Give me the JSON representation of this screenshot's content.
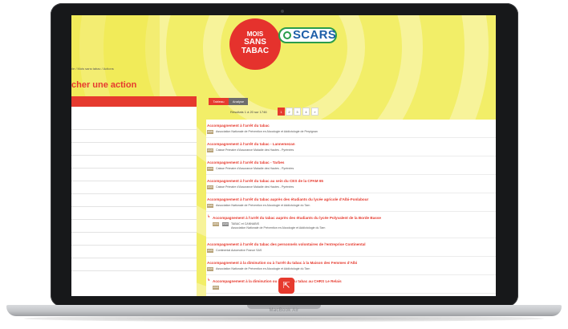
{
  "device": {
    "label": "MacBook Air"
  },
  "logo": {
    "line1": "MOIS",
    "line2": "SANS",
    "line3": "TABAC"
  },
  "brand": {
    "name": "SCARS",
    "colors": {
      "red": "#e63a2e",
      "yellow": "#f2ee68",
      "green": "#2a9d4b",
      "blue": "#1d5ea8"
    }
  },
  "breadcrumb": "ıle  /  Mois sans tabac  /  Actions",
  "page_title": "cher une action",
  "tabs": [
    {
      "label": "Tableau"
    },
    {
      "label": "Analyse"
    }
  ],
  "results": {
    "text": "Résultats 1 à 20 sur 1746"
  },
  "pagination": [
    "1",
    "2",
    "3",
    "4",
    "»"
  ],
  "items": [
    {
      "title": "Accompagnement à l'arrêt du tabac",
      "tag": "2020",
      "org": "Association Nationale de Prévention en Alcoologie et Addictologie de Perpignan"
    },
    {
      "title": "Accompagnement à l'arrêt du tabac - Lannemezan",
      "tag": "2020",
      "org": "Caisse Primaire d'Assurance Maladie des Hautes - Pyrénées"
    },
    {
      "title": "Accompagnement à l'arrêt du tabac - Tarbes",
      "tag": "2020",
      "org": "Caisse Primaire d'Assurance Maladie des Hautes - Pyrénées"
    },
    {
      "title": "Accompagnement à l'arrêt du tabac au sein du CES de la CPAM 65",
      "tag": "2020",
      "org": "Caisse Primaire d'Assurance Maladie des Hautes - Pyrénées"
    },
    {
      "title": "Accompagnement à l'arrêt du tabac auprès des étudiants du lycée agricole d'Albi-Fonlabour",
      "tag": "2020",
      "org": "Association Nationale de Prévention en Alcoologie et Addictologie du Tarn"
    },
    {
      "title": "Accompagnement à l'arrêt du tabac auprès des étudiants du lycée Polyvalent de la Borde Basse",
      "tag": "2019",
      "tag2": "2020",
      "theme": "TABAC et CANNABIS",
      "org": "Association Nationale de Prévention en Alcoologie et Addictologie du Tarn"
    },
    {
      "title": "Accompagnement à l'arrêt du tabac des personnels volontaires de l'entreprise Continental",
      "tag": "2020",
      "org": "Continental Automotive France SAS"
    },
    {
      "title": "Accompagnement à la diminution ou à l'arrêt du tabac à la Maison des Femmes d'Albi",
      "tag": "2020",
      "org": "Association Nationale de Prévention en Alcoologie et Addictologie du Tarn"
    },
    {
      "title": "Accompagnement à la diminution ou à l'arrêt du tabac au CHRS Le Relais",
      "tag": "2020",
      "org": ""
    }
  ]
}
